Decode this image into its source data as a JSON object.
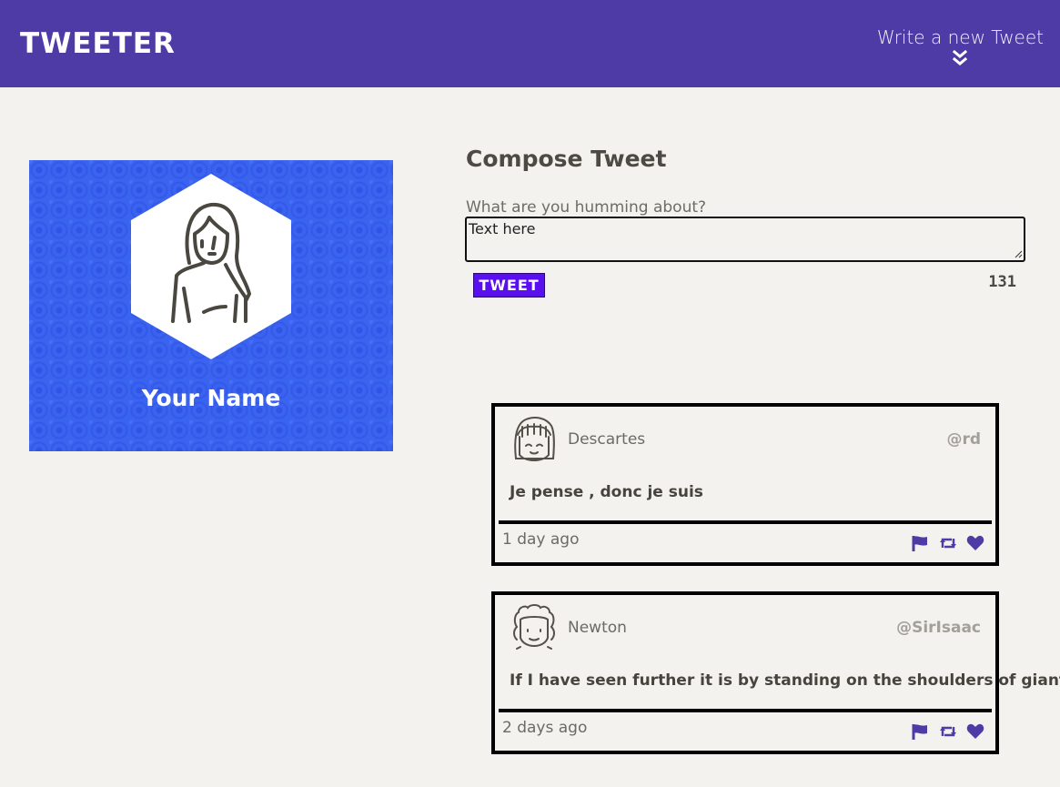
{
  "nav": {
    "brand": "TWEETER",
    "write_new_label": "Write a new Tweet"
  },
  "profile": {
    "name": "Your Name",
    "background_color": "#3a63f0"
  },
  "compose": {
    "title": "Compose Tweet",
    "label": "What are you humming about?",
    "textarea_value": "Text here",
    "tweet_button": "TWEET",
    "counter": "131"
  },
  "tweets": [
    {
      "author": "Descartes",
      "handle": "@rd",
      "text": "Je pense , donc je suis",
      "time": "1 day ago"
    },
    {
      "author": "Newton",
      "handle": "@SirIsaac",
      "text": "If I have seen further it is by standing on the shoulders of giants",
      "time": "2 days ago"
    }
  ],
  "colors": {
    "nav_bg": "#4e3ba6",
    "accent_purple": "#5a0ff0",
    "icon_purple": "#4e3ba6",
    "page_bg": "#f3f2ee"
  },
  "icons": {
    "chevron": "double-chevron-down-icon",
    "flag": "flag-icon",
    "retweet": "retweet-icon",
    "heart": "heart-icon"
  }
}
